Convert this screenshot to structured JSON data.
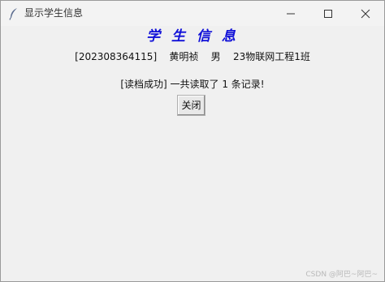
{
  "window": {
    "title": "显示学生信息",
    "icon": "feather-icon",
    "controls": [
      "minimize-icon",
      "maximize-icon",
      "close-icon"
    ]
  },
  "content": {
    "heading": "学 生 信 息",
    "student_id": "[202308364115]",
    "name": "黄明祯",
    "gender": "男",
    "class_name": "23物联网工程1班",
    "status": "[读档成功] 一共读取了 1 条记录!",
    "close_button_label": "关闭"
  },
  "colors": {
    "heading": "#1010d8",
    "window_background": "#f0f0f0"
  },
  "watermark": "CSDN @阿巴~阿巴~"
}
